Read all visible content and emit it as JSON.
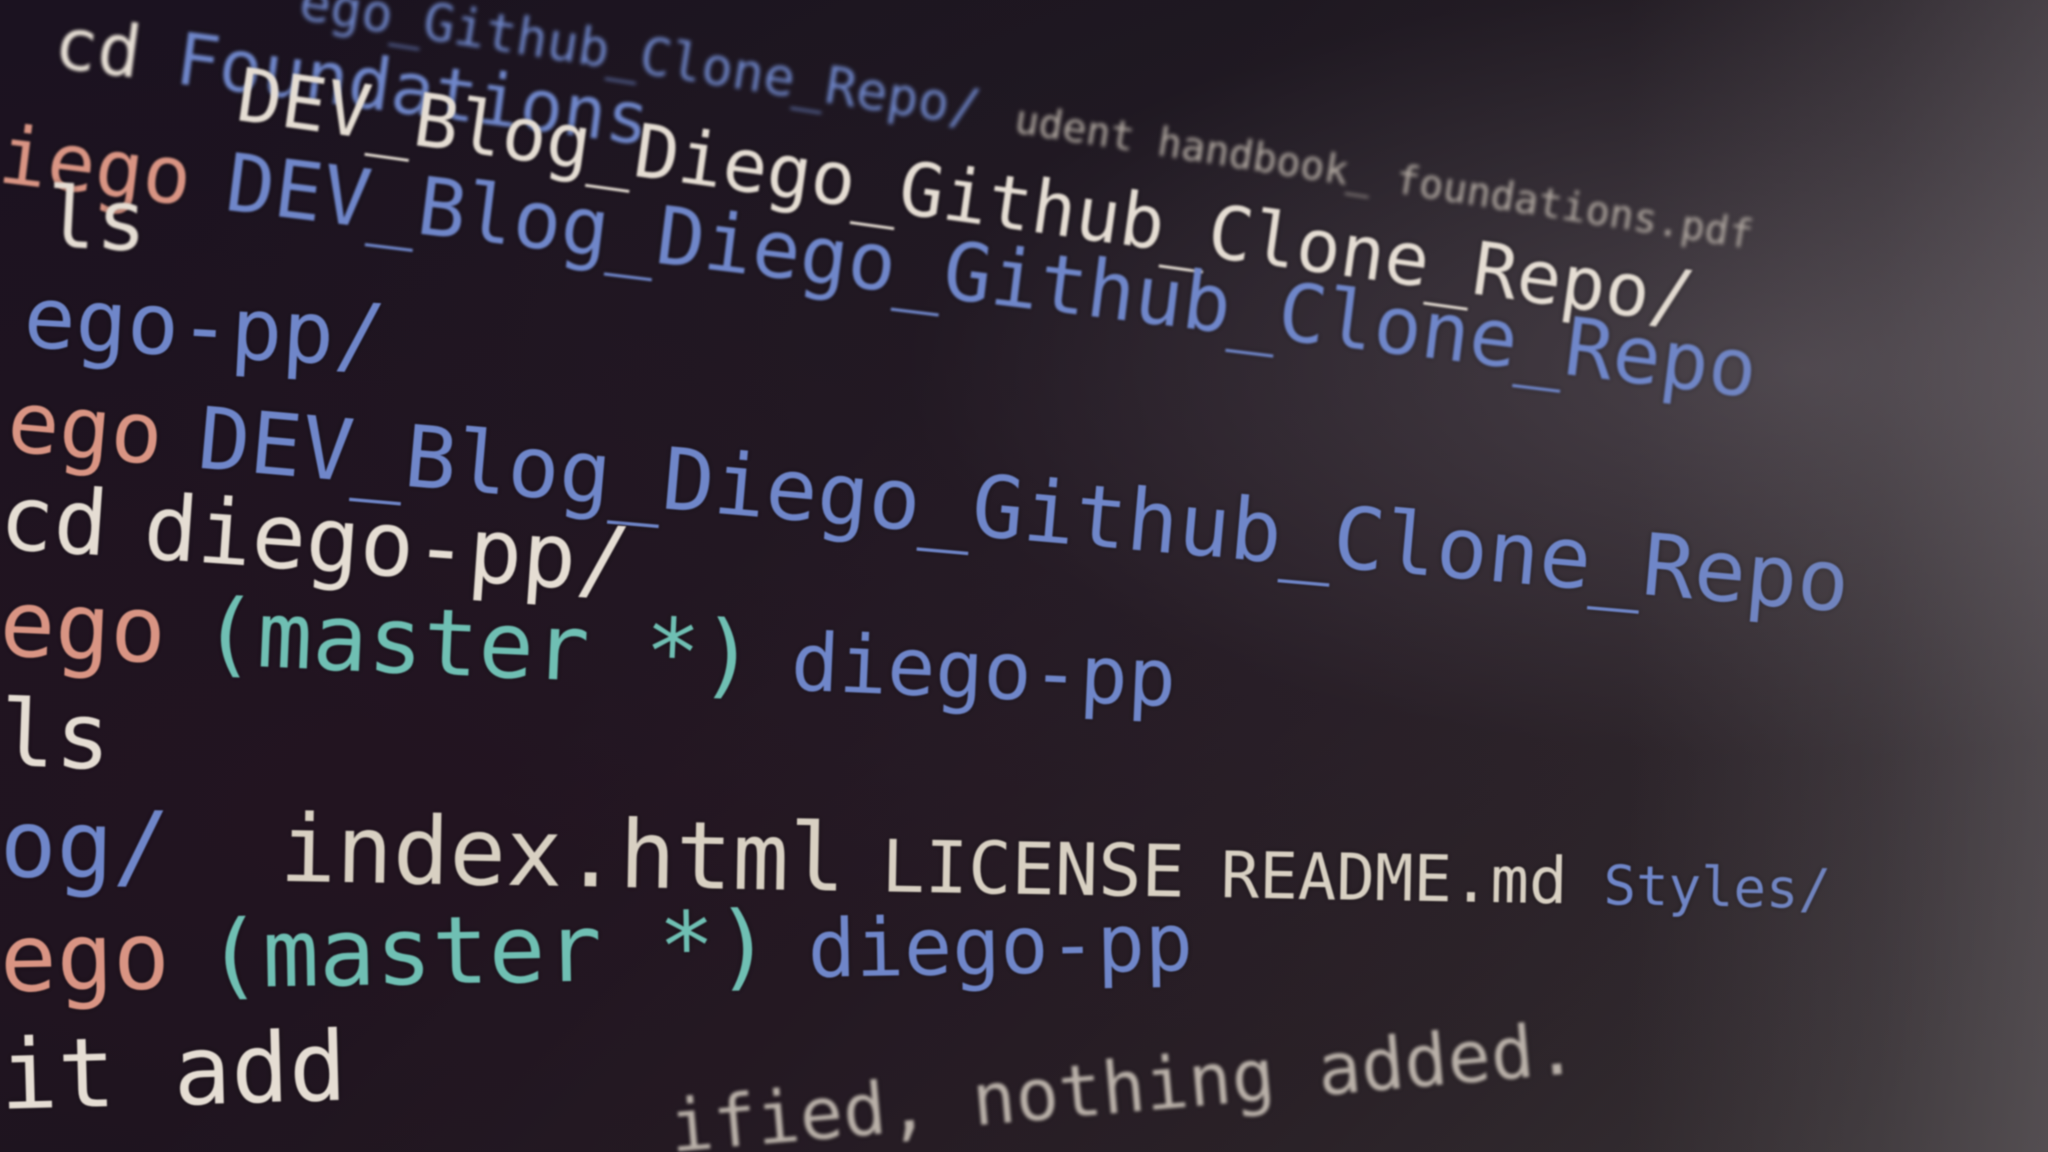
{
  "terminal": {
    "lines": [
      {
        "segments": [
          {
            "text": "ego_Github_Clone_Repo/",
            "role": "dir"
          },
          {
            "text": "udent handbook_ foundations.pdf",
            "role": "muted"
          }
        ]
      },
      {
        "segments": [
          {
            "text": "cd",
            "role": "cmd"
          },
          {
            "text": "Foundations",
            "role": "dir"
          }
        ]
      },
      {
        "segments": [
          {
            "text": "DEV_Blog_Diego_Github_Clone_Repo/",
            "role": "cmd"
          }
        ]
      },
      {
        "segments": [
          {
            "text": "iego",
            "role": "prompt"
          },
          {
            "text": "DEV_Blog_Diego_Github_Clone_Repo",
            "role": "dir"
          }
        ]
      },
      {
        "segments": [
          {
            "text": "ls",
            "role": "cmd"
          }
        ]
      },
      {
        "segments": [
          {
            "text": "ego-pp/",
            "role": "dir"
          }
        ]
      },
      {
        "segments": [
          {
            "text": "ego",
            "role": "prompt"
          },
          {
            "text": "DEV_Blog_Diego_Github_Clone_Repo",
            "role": "dir"
          }
        ]
      },
      {
        "segments": [
          {
            "text": "cd",
            "role": "cmd"
          },
          {
            "text": "diego-pp/",
            "role": "cmd"
          }
        ]
      },
      {
        "segments": [
          {
            "text": "ego",
            "role": "prompt"
          },
          {
            "text": "(master *)",
            "role": "branch"
          },
          {
            "text": "diego-pp",
            "role": "dir"
          }
        ]
      },
      {
        "segments": [
          {
            "text": "ls",
            "role": "cmd"
          }
        ]
      },
      {
        "segments": [
          {
            "text": "og/",
            "role": "dir"
          },
          {
            "text": "index.html",
            "role": "file"
          },
          {
            "text": "LICENSE",
            "role": "file"
          },
          {
            "text": "README.md",
            "role": "file"
          },
          {
            "text": "Styles/",
            "role": "dir"
          }
        ]
      },
      {
        "segments": [
          {
            "text": "ego",
            "role": "prompt"
          },
          {
            "text": "(master *)",
            "role": "branch"
          },
          {
            "text": "diego-pp",
            "role": "dir"
          }
        ]
      },
      {
        "segments": [
          {
            "text": "it add",
            "role": "cmd"
          }
        ]
      },
      {
        "segments": [
          {
            "text": "ified, nothing added.",
            "role": "muted"
          }
        ]
      }
    ],
    "colors": {
      "prompt": "#d99483",
      "command": "#e5ddd3",
      "directory": "#6f86c9",
      "branch": "#6fbfb3",
      "file": "#d8d0c2"
    }
  }
}
